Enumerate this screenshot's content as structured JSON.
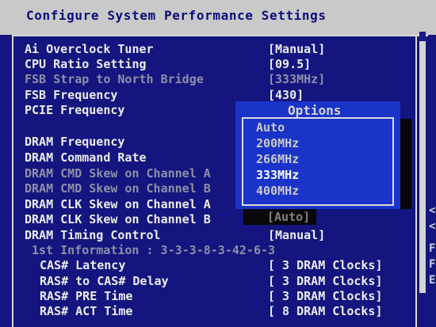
{
  "header": {
    "title": "Configure System Performance Settings"
  },
  "settings": [
    {
      "label": "Ai Overclock Tuner",
      "value": "[Manual]",
      "dim": false
    },
    {
      "label": "CPU Ratio Setting",
      "value": "[09.5]",
      "dim": false
    },
    {
      "label": "FSB Strap to North Bridge",
      "value": "[333MHz]",
      "dim": true
    },
    {
      "label": "FSB Frequency",
      "value": "[430]",
      "dim": false
    },
    {
      "label": "PCIE Frequency",
      "value": "",
      "dim": false
    },
    {
      "label": "DRAM Frequency",
      "value": "",
      "dim": false
    },
    {
      "label": "DRAM Command Rate",
      "value": "",
      "dim": false
    },
    {
      "label": "DRAM CMD Skew on Channel A",
      "value": "",
      "dim": true
    },
    {
      "label": "DRAM CMD Skew on Channel B",
      "value": "",
      "dim": true
    },
    {
      "label": "DRAM CLK Skew on Channel A",
      "value": "",
      "dim": false
    },
    {
      "label": "DRAM CLK Skew on Channel B",
      "value": "[Auto]",
      "dim": false
    },
    {
      "label": "DRAM Timing Control",
      "value": "[Manual]",
      "dim": false
    },
    {
      "label": "1st Information : 3-3-3-8-3-42-6-3",
      "value": "",
      "dim": true
    },
    {
      "label": "CAS# Latency",
      "value": "[ 3 DRAM Clocks]",
      "dim": false
    },
    {
      "label": "RAS# to CAS# Delay",
      "value": "[ 3 DRAM Clocks]",
      "dim": false
    },
    {
      "label": "RAS# PRE Time",
      "value": "[ 3 DRAM Clocks]",
      "dim": false
    },
    {
      "label": "RAS# ACT Time",
      "value": "[ 8 DRAM Clocks]",
      "dim": false
    }
  ],
  "popup": {
    "title": "Options",
    "options": [
      "Auto",
      "200MHz",
      "266MHz",
      "333MHz",
      "400MHz"
    ],
    "selected": "333MHz"
  },
  "side_letters": [
    "<",
    "<",
    "F",
    "F",
    "E"
  ]
}
